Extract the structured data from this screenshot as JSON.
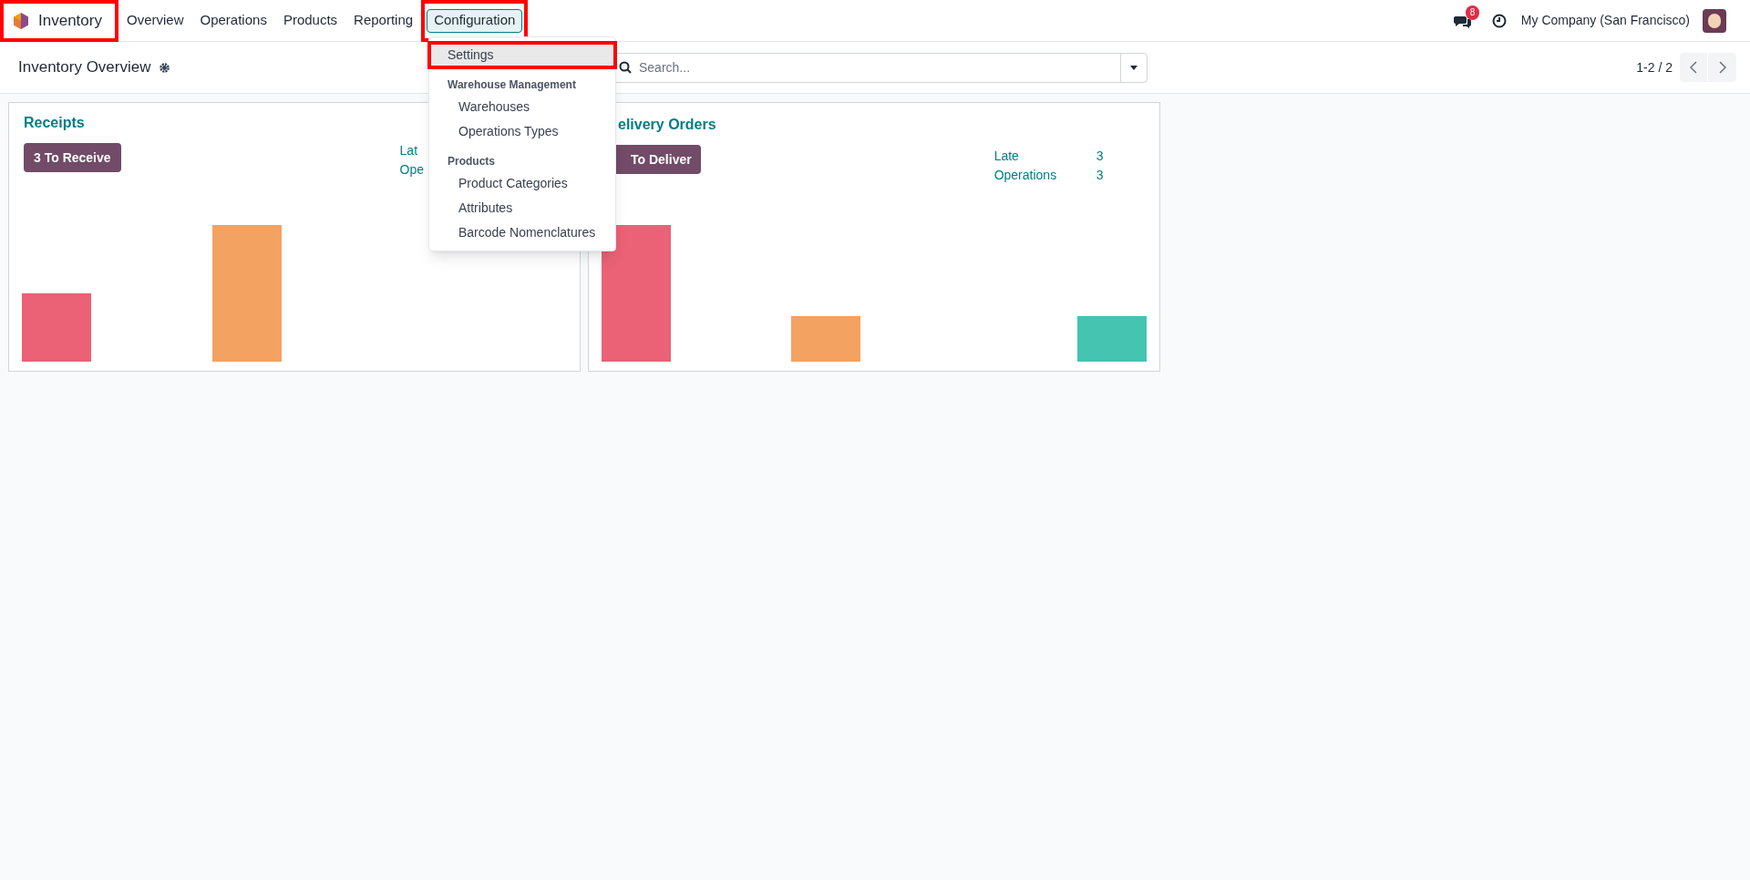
{
  "navbar": {
    "app": {
      "label": "Inventory",
      "highlighted": true
    },
    "menu": [
      {
        "label": "Overview",
        "open": false,
        "highlighted": false
      },
      {
        "label": "Operations",
        "open": false,
        "highlighted": false
      },
      {
        "label": "Products",
        "open": false,
        "highlighted": false
      },
      {
        "label": "Reporting",
        "open": false,
        "highlighted": false
      },
      {
        "label": "Configuration",
        "open": true,
        "highlighted": true
      }
    ],
    "messages_badge": "8",
    "company": "My Company (San Francisco)"
  },
  "dropdown": {
    "items": [
      {
        "kind": "item",
        "label": "Settings",
        "hovered": true,
        "highlighted": true
      },
      {
        "kind": "header",
        "label": "Warehouse Management"
      },
      {
        "kind": "subitem",
        "label": "Warehouses",
        "hovered": false,
        "highlighted": false
      },
      {
        "kind": "subitem",
        "label": "Operations Types",
        "hovered": false,
        "highlighted": false
      },
      {
        "kind": "header",
        "label": "Products"
      },
      {
        "kind": "subitem",
        "label": "Product Categories",
        "hovered": false,
        "highlighted": false
      },
      {
        "kind": "subitem",
        "label": "Attributes",
        "hovered": false,
        "highlighted": false
      },
      {
        "kind": "subitem",
        "label": "Barcode Nomenclatures",
        "hovered": false,
        "highlighted": false
      }
    ]
  },
  "control_panel": {
    "title": "Inventory Overview",
    "search_placeholder": "Search...",
    "pager": "1-2 / 2"
  },
  "cards": [
    {
      "title": "Receipts",
      "button": "3 To Receive",
      "stats": [
        {
          "label": "Lat"
        },
        {
          "label": "Ope"
        }
      ]
    },
    {
      "title": "elivery Orders",
      "button": "To Deliver",
      "stats": [
        {
          "label": "Late",
          "value": "3"
        },
        {
          "label": "Operations",
          "value": "3"
        }
      ]
    }
  ]
}
